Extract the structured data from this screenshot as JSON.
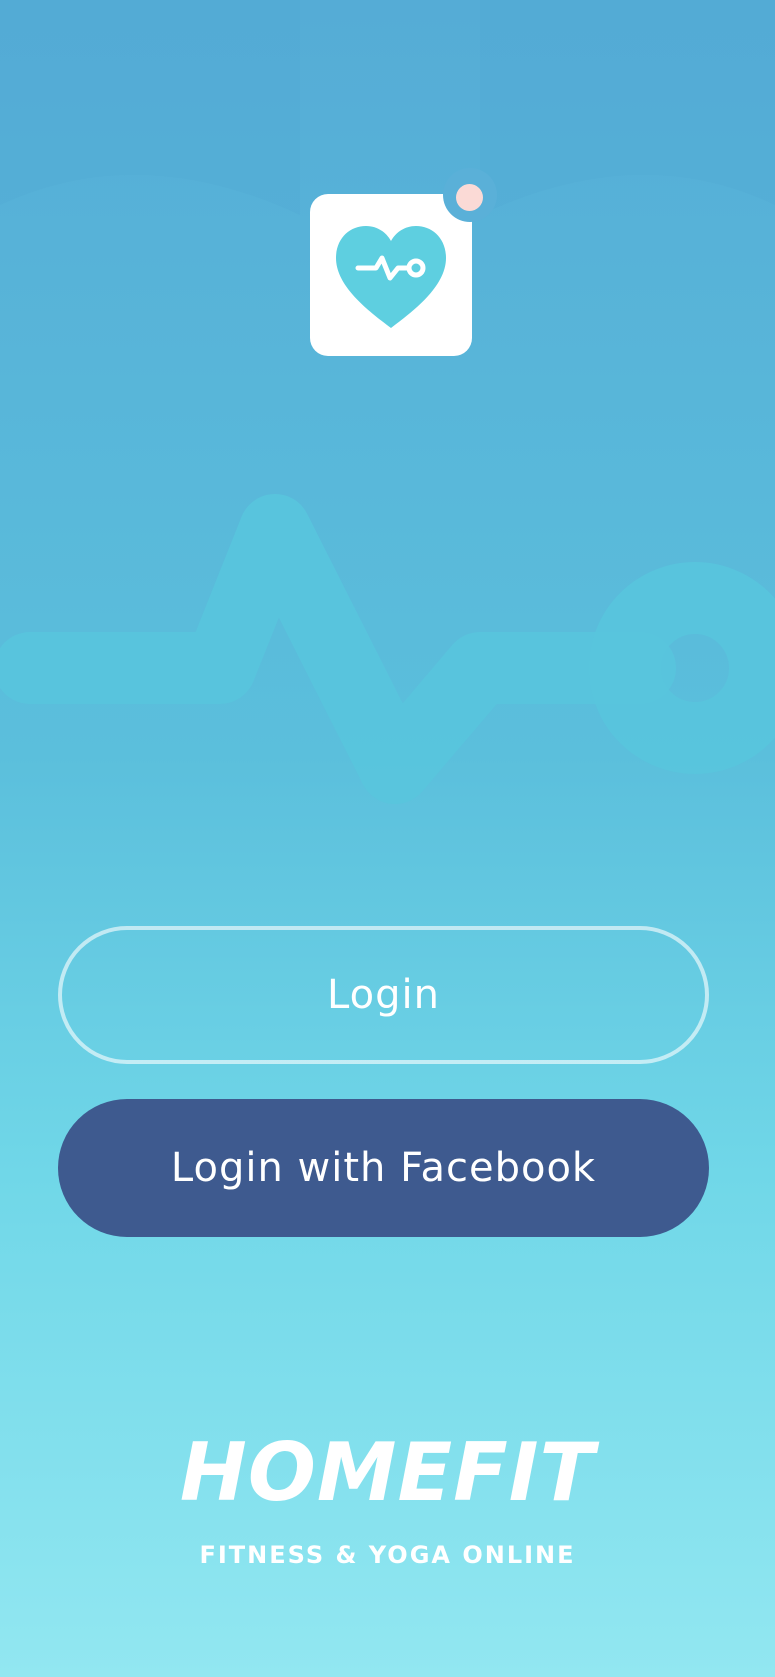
{
  "app": {
    "logo_icon": "heart-pulse-icon",
    "has_notification": true
  },
  "buttons": {
    "login_label": "Login",
    "facebook_label": "Login with Facebook"
  },
  "brand": {
    "name": "HOMEFIT",
    "tagline": "FITNESS & YOGA ONLINE"
  },
  "colors": {
    "gradient_top": "#55acd6",
    "gradient_bottom": "#92e7f1",
    "icon_heart": "#5ecfe0",
    "facebook_button": "#3e5a8f",
    "notification_dot": "#fbdad6"
  }
}
